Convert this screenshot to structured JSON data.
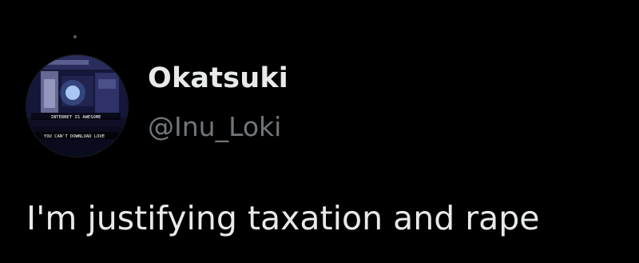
{
  "tweet": {
    "author": {
      "display_name": "Okatsuki",
      "handle": "@Inu_Loki",
      "avatar": {
        "icon": "avatar-image",
        "caption_top": "INTERNET IS AWESOME",
        "caption_bottom": "YOU CAN'T DOWNLOAD LOVE"
      }
    },
    "text": "I'm justifying taxation and rape"
  },
  "colors": {
    "background": "#000000",
    "primary_text": "#e7e9ea",
    "secondary_text": "#71767b"
  }
}
